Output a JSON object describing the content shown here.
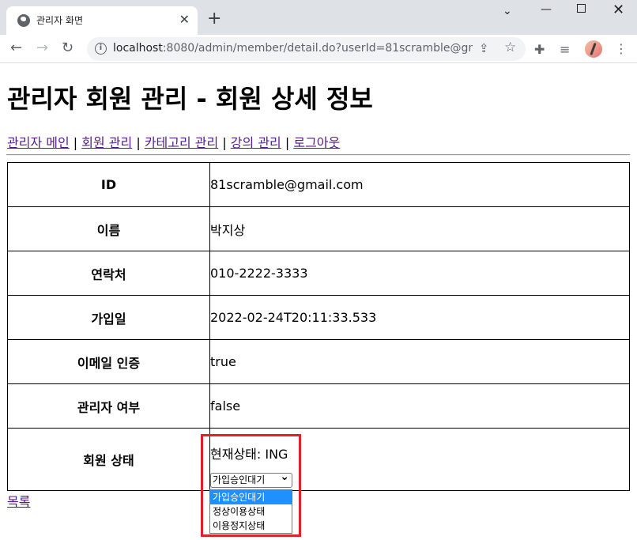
{
  "browser": {
    "tab_title": "관리자 화면",
    "new_tab": "+",
    "url_host": "localhost",
    "url_rest": ":8080/admin/member/detail.do?userId=81scramble@gmail.c..."
  },
  "page": {
    "title": "관리자 회원 관리 - 회원 상세 정보",
    "nav": {
      "main": "관리자 메인",
      "member": "회원 관리",
      "category": "카테고리 관리",
      "course": "강의 관리",
      "logout": "로그아웃",
      "separator": "|"
    },
    "rows": [
      {
        "label": "ID",
        "value": "81scramble@gmail.com"
      },
      {
        "label": "이름",
        "value": "박지상"
      },
      {
        "label": "연락처",
        "value": "010-2222-3333"
      },
      {
        "label": "가입일",
        "value": "2022-02-24T20:11:33.533"
      },
      {
        "label": "이메일 인증",
        "value": "true"
      },
      {
        "label": "관리자 여부",
        "value": "false"
      }
    ],
    "status": {
      "label": "회원 상태",
      "current_text": "현재상태: ING",
      "selected": "가입승인대기",
      "options": [
        "가입승인대기",
        "정상이용상태",
        "이용정지상태"
      ]
    },
    "list_link": "목록"
  },
  "colors": {
    "highlight": "#e0212b",
    "link_visited": "#551a8b",
    "option_selected": "#1e90ff"
  }
}
